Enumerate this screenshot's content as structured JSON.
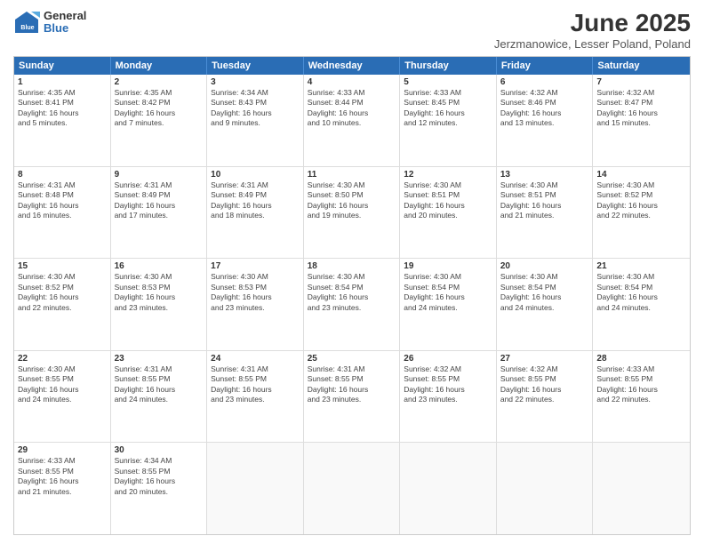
{
  "header": {
    "logo": {
      "general": "General",
      "blue": "Blue"
    },
    "title": "June 2025",
    "subtitle": "Jerzmanowice, Lesser Poland, Poland"
  },
  "days_of_week": [
    "Sunday",
    "Monday",
    "Tuesday",
    "Wednesday",
    "Thursday",
    "Friday",
    "Saturday"
  ],
  "weeks": [
    [
      {
        "day": "1",
        "info": "Sunrise: 4:35 AM\nSunset: 8:41 PM\nDaylight: 16 hours\nand 5 minutes."
      },
      {
        "day": "2",
        "info": "Sunrise: 4:35 AM\nSunset: 8:42 PM\nDaylight: 16 hours\nand 7 minutes."
      },
      {
        "day": "3",
        "info": "Sunrise: 4:34 AM\nSunset: 8:43 PM\nDaylight: 16 hours\nand 9 minutes."
      },
      {
        "day": "4",
        "info": "Sunrise: 4:33 AM\nSunset: 8:44 PM\nDaylight: 16 hours\nand 10 minutes."
      },
      {
        "day": "5",
        "info": "Sunrise: 4:33 AM\nSunset: 8:45 PM\nDaylight: 16 hours\nand 12 minutes."
      },
      {
        "day": "6",
        "info": "Sunrise: 4:32 AM\nSunset: 8:46 PM\nDaylight: 16 hours\nand 13 minutes."
      },
      {
        "day": "7",
        "info": "Sunrise: 4:32 AM\nSunset: 8:47 PM\nDaylight: 16 hours\nand 15 minutes."
      }
    ],
    [
      {
        "day": "8",
        "info": "Sunrise: 4:31 AM\nSunset: 8:48 PM\nDaylight: 16 hours\nand 16 minutes."
      },
      {
        "day": "9",
        "info": "Sunrise: 4:31 AM\nSunset: 8:49 PM\nDaylight: 16 hours\nand 17 minutes."
      },
      {
        "day": "10",
        "info": "Sunrise: 4:31 AM\nSunset: 8:49 PM\nDaylight: 16 hours\nand 18 minutes."
      },
      {
        "day": "11",
        "info": "Sunrise: 4:30 AM\nSunset: 8:50 PM\nDaylight: 16 hours\nand 19 minutes."
      },
      {
        "day": "12",
        "info": "Sunrise: 4:30 AM\nSunset: 8:51 PM\nDaylight: 16 hours\nand 20 minutes."
      },
      {
        "day": "13",
        "info": "Sunrise: 4:30 AM\nSunset: 8:51 PM\nDaylight: 16 hours\nand 21 minutes."
      },
      {
        "day": "14",
        "info": "Sunrise: 4:30 AM\nSunset: 8:52 PM\nDaylight: 16 hours\nand 22 minutes."
      }
    ],
    [
      {
        "day": "15",
        "info": "Sunrise: 4:30 AM\nSunset: 8:52 PM\nDaylight: 16 hours\nand 22 minutes."
      },
      {
        "day": "16",
        "info": "Sunrise: 4:30 AM\nSunset: 8:53 PM\nDaylight: 16 hours\nand 23 minutes."
      },
      {
        "day": "17",
        "info": "Sunrise: 4:30 AM\nSunset: 8:53 PM\nDaylight: 16 hours\nand 23 minutes."
      },
      {
        "day": "18",
        "info": "Sunrise: 4:30 AM\nSunset: 8:54 PM\nDaylight: 16 hours\nand 23 minutes."
      },
      {
        "day": "19",
        "info": "Sunrise: 4:30 AM\nSunset: 8:54 PM\nDaylight: 16 hours\nand 24 minutes."
      },
      {
        "day": "20",
        "info": "Sunrise: 4:30 AM\nSunset: 8:54 PM\nDaylight: 16 hours\nand 24 minutes."
      },
      {
        "day": "21",
        "info": "Sunrise: 4:30 AM\nSunset: 8:54 PM\nDaylight: 16 hours\nand 24 minutes."
      }
    ],
    [
      {
        "day": "22",
        "info": "Sunrise: 4:30 AM\nSunset: 8:55 PM\nDaylight: 16 hours\nand 24 minutes."
      },
      {
        "day": "23",
        "info": "Sunrise: 4:31 AM\nSunset: 8:55 PM\nDaylight: 16 hours\nand 24 minutes."
      },
      {
        "day": "24",
        "info": "Sunrise: 4:31 AM\nSunset: 8:55 PM\nDaylight: 16 hours\nand 23 minutes."
      },
      {
        "day": "25",
        "info": "Sunrise: 4:31 AM\nSunset: 8:55 PM\nDaylight: 16 hours\nand 23 minutes."
      },
      {
        "day": "26",
        "info": "Sunrise: 4:32 AM\nSunset: 8:55 PM\nDaylight: 16 hours\nand 23 minutes."
      },
      {
        "day": "27",
        "info": "Sunrise: 4:32 AM\nSunset: 8:55 PM\nDaylight: 16 hours\nand 22 minutes."
      },
      {
        "day": "28",
        "info": "Sunrise: 4:33 AM\nSunset: 8:55 PM\nDaylight: 16 hours\nand 22 minutes."
      }
    ],
    [
      {
        "day": "29",
        "info": "Sunrise: 4:33 AM\nSunset: 8:55 PM\nDaylight: 16 hours\nand 21 minutes."
      },
      {
        "day": "30",
        "info": "Sunrise: 4:34 AM\nSunset: 8:55 PM\nDaylight: 16 hours\nand 20 minutes."
      },
      {
        "day": "",
        "info": ""
      },
      {
        "day": "",
        "info": ""
      },
      {
        "day": "",
        "info": ""
      },
      {
        "day": "",
        "info": ""
      },
      {
        "day": "",
        "info": ""
      }
    ]
  ]
}
